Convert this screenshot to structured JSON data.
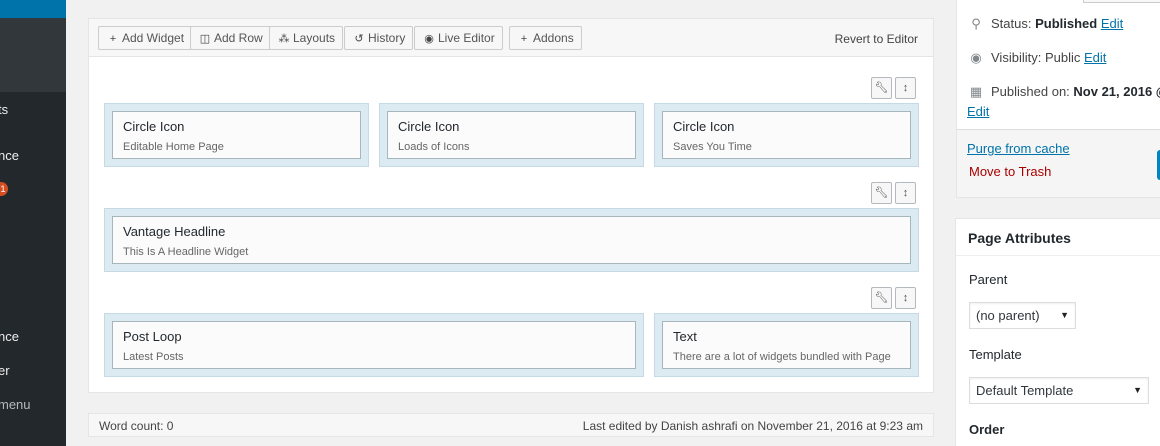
{
  "admin_menu": {
    "items": [
      {
        "label": "ts"
      },
      {
        "label": "nce"
      },
      {
        "badge": "1"
      },
      {
        "label": "nce"
      },
      {
        "label": "er"
      },
      {
        "label": "menu"
      }
    ],
    "accent": "#0073aa"
  },
  "toolbar": {
    "add_widget": "Add Widget",
    "add_row": "Add Row",
    "layouts": "Layouts",
    "history": "History",
    "live_editor": "Live Editor",
    "addons": "Addons",
    "revert": "Revert to Editor"
  },
  "rows": [
    {
      "cells": [
        {
          "title": "Circle Icon",
          "desc": "Editable Home Page"
        },
        {
          "title": "Circle Icon",
          "desc": "Loads of Icons"
        },
        {
          "title": "Circle Icon",
          "desc": "Saves You Time"
        }
      ]
    },
    {
      "cells": [
        {
          "title": "Vantage Headline",
          "desc": "This Is A Headline Widget"
        }
      ]
    },
    {
      "cells": [
        {
          "title": "Post Loop",
          "desc": "Latest Posts"
        },
        {
          "title": "Text",
          "desc": "There are a lot of widgets bundled with Page"
        }
      ]
    }
  ],
  "status_bar": {
    "word_count": "Word count: 0",
    "last_edited": "Last edited by Danish ashrafi on November 21, 2016 at 9:23 am"
  },
  "publish": {
    "status_label": "Status:",
    "status_value": "Published",
    "visibility_label": "Visibility:",
    "visibility_value": "Public",
    "published_label": "Published on:",
    "published_value": "Nov 21, 2016 @",
    "edit": "Edit",
    "purge": "Purge from cache",
    "trash": "Move to Trash"
  },
  "page_attributes": {
    "title": "Page Attributes",
    "parent_label": "Parent",
    "parent_value": "(no parent)",
    "template_label": "Template",
    "template_value": "Default Template",
    "order_label": "Order"
  }
}
